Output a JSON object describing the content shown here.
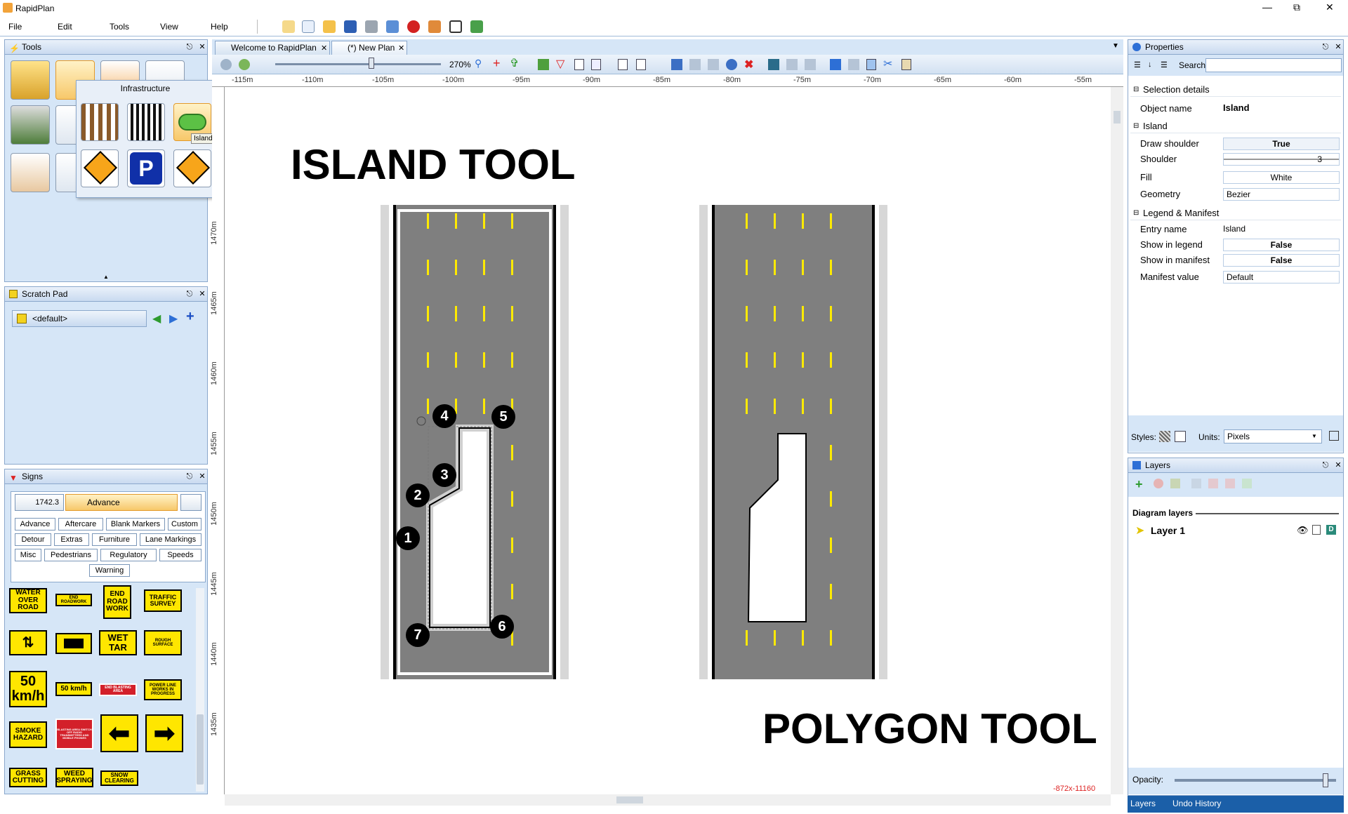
{
  "app": {
    "title": "RapidPlan"
  },
  "menu": {
    "items": [
      "File",
      "Edit",
      "Tools",
      "View",
      "Help"
    ]
  },
  "tools": {
    "title": "Tools",
    "flyout_title": "Infrastructure",
    "tooltip": "Island"
  },
  "scratch": {
    "title": "Scratch Pad",
    "default_label": "<default>"
  },
  "signs": {
    "title": "Signs",
    "standard": "1742.3",
    "category": "Advance",
    "buttons": [
      "Advance",
      "Aftercare",
      "Blank Markers",
      "Custom",
      "Detour",
      "Extras",
      "Furniture",
      "Lane Markings",
      "Misc",
      "Pedestrians",
      "Regulatory",
      "Speeds",
      "Warning"
    ],
    "items": [
      "WATER OVER ROAD",
      "END ROADWORK",
      "END ROAD WORK",
      "TRAFFIC SURVEY",
      "WET TAR",
      "ROUGH SURFACE",
      "50 km/h",
      "50 km/h",
      "END BLASTING AREA",
      "POWER LINE WORKS IN PROGRESS",
      "SMOKE HAZARD",
      "BLASTING AREA SWITCH OFF RADIO TRANSMITTERS AND MOBILE PHONES",
      "GRASS CUTTING",
      "WEED SPRAYING",
      "SNOW CLEARING"
    ]
  },
  "tabs": [
    {
      "label": "Welcome to RapidPlan"
    },
    {
      "label": "(*) New Plan"
    }
  ],
  "zoom": {
    "label": "270%"
  },
  "ruler": {
    "h": [
      "-115m",
      "-110m",
      "-105m",
      "-100m",
      "-95m",
      "-90m",
      "-85m",
      "-80m",
      "-75m",
      "-70m",
      "-65m",
      "-60m",
      "-55m"
    ],
    "v": [
      "1470m",
      "1465m",
      "1460m",
      "1455m",
      "1450m",
      "1445m",
      "1440m",
      "1435m"
    ]
  },
  "canvas": {
    "island_title": "ISLAND TOOL",
    "polygon_title": "POLYGON TOOL",
    "coords": "-872x-11160",
    "points": [
      "1",
      "2",
      "3",
      "4",
      "5",
      "6",
      "7"
    ]
  },
  "properties": {
    "title": "Properties",
    "search_label": "Search:",
    "sections": [
      {
        "name": "Selection details",
        "rows": [
          {
            "k": "Object name",
            "v": "Island"
          }
        ]
      },
      {
        "name": "Island",
        "rows": [
          {
            "k": "Draw shoulder",
            "v": "True"
          },
          {
            "k": "Shoulder",
            "v": "3"
          },
          {
            "k": "Fill",
            "v": "White"
          },
          {
            "k": "Geometry",
            "v": "Bezier"
          }
        ]
      },
      {
        "name": "Legend & Manifest",
        "rows": [
          {
            "k": "Entry name",
            "v": "Island"
          },
          {
            "k": "Show in legend",
            "v": "False"
          },
          {
            "k": "Show in manifest",
            "v": "False"
          },
          {
            "k": "Manifest value",
            "v": "Default"
          }
        ]
      }
    ],
    "styles_label": "Styles:",
    "units_label": "Units:",
    "units_value": "Pixels"
  },
  "layers": {
    "title": "Layers",
    "diagram_layers": "Diagram layers",
    "layer_name": "Layer 1",
    "opacity_label": "Opacity:",
    "opacity": 0.95
  },
  "bottom_tabs": [
    "Layers",
    "Undo History"
  ],
  "colors": {
    "panel": "#d6e6f7",
    "road": "#7f7f7f",
    "lane": "#ffea00",
    "accent": "#f7c86a"
  }
}
